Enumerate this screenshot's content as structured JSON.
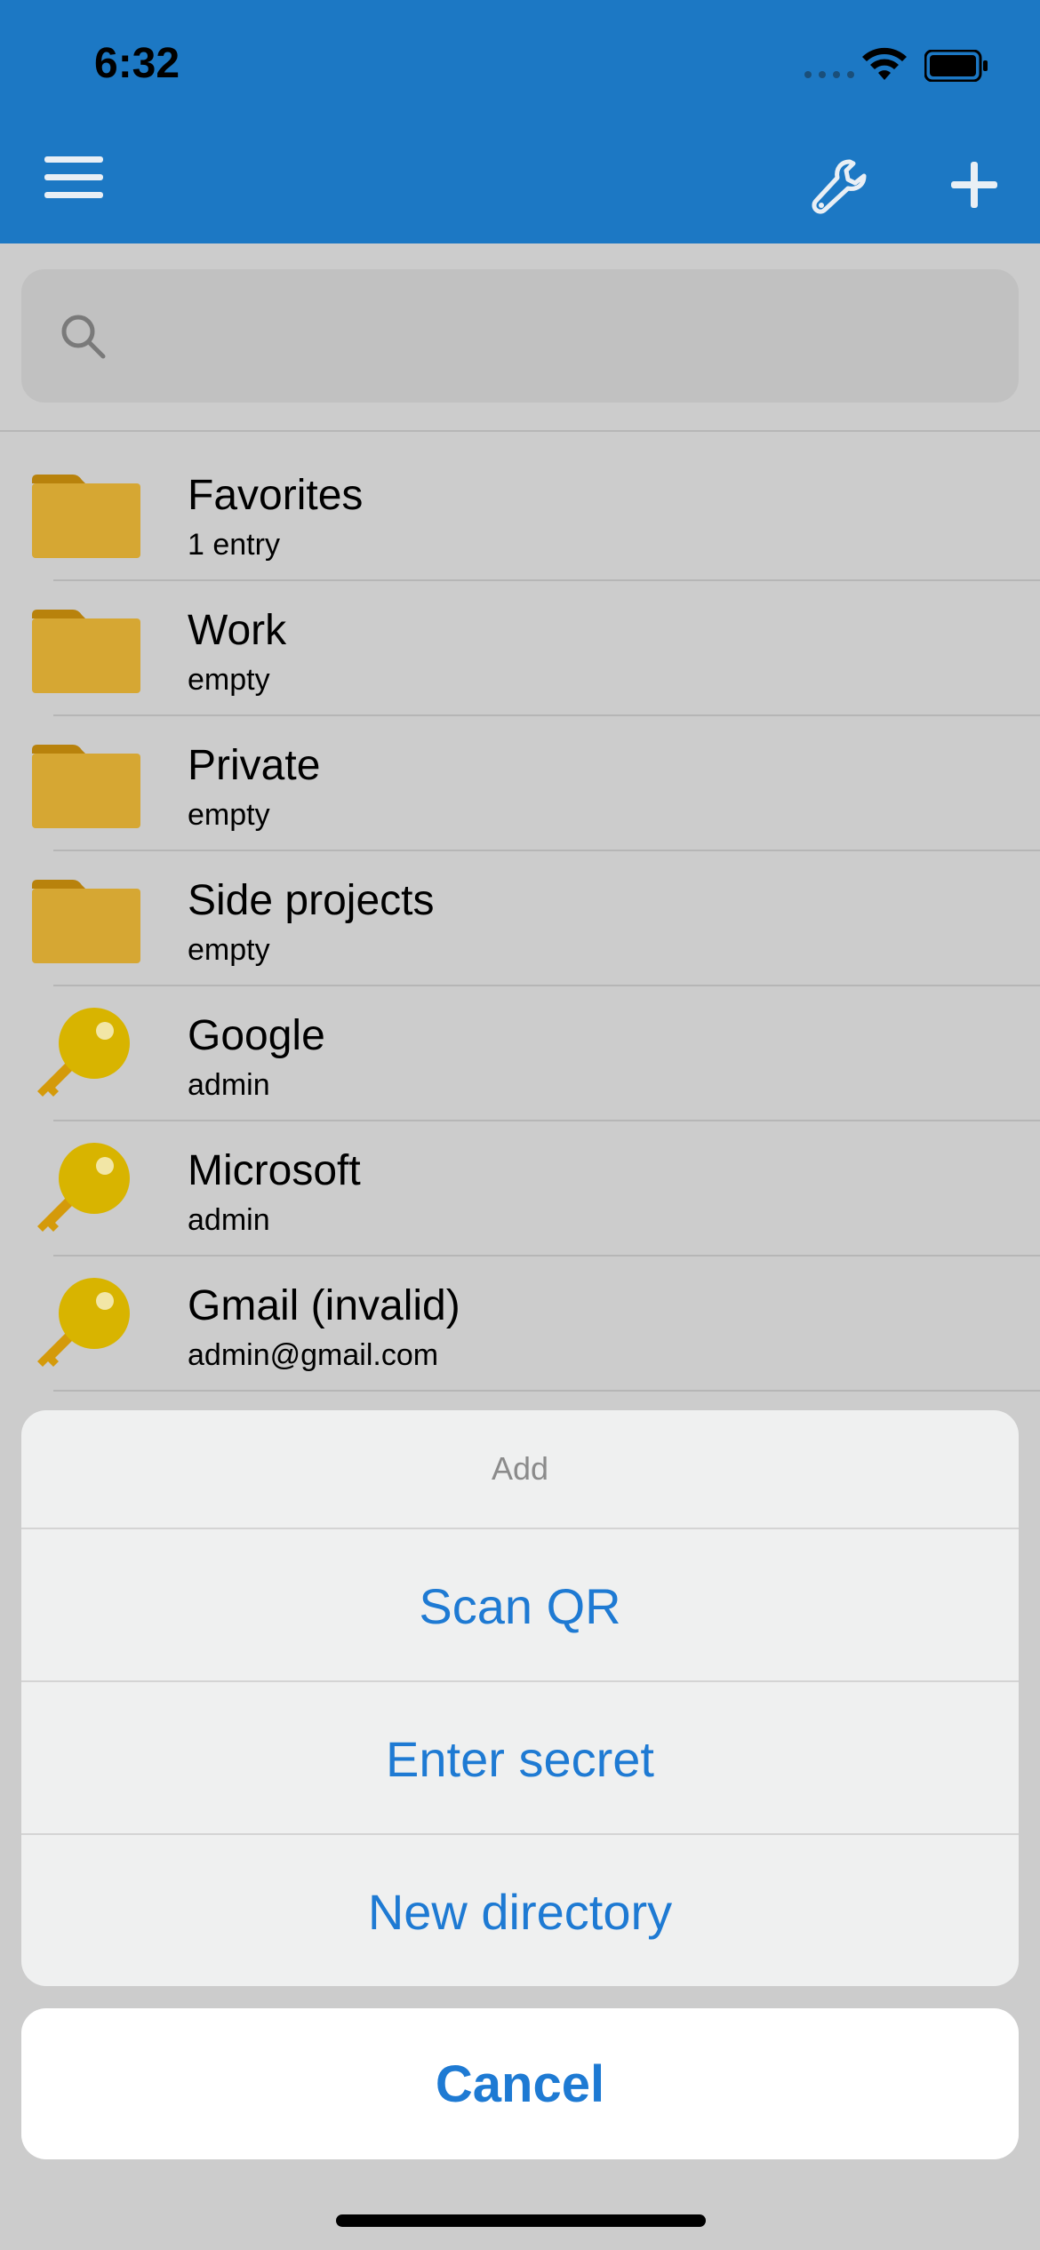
{
  "status": {
    "time": "6:32"
  },
  "nav": {
    "menu_icon": "hamburger-menu-icon",
    "tools_icon": "wrench-icon",
    "add_icon": "plus-icon"
  },
  "search": {
    "placeholder": ""
  },
  "list": [
    {
      "type": "folder",
      "title": "Favorites",
      "subtitle": "1 entry"
    },
    {
      "type": "folder",
      "title": "Work",
      "subtitle": "empty"
    },
    {
      "type": "folder",
      "title": "Private",
      "subtitle": "empty"
    },
    {
      "type": "folder",
      "title": "Side projects",
      "subtitle": "empty"
    },
    {
      "type": "key",
      "title": "Google",
      "subtitle": "admin"
    },
    {
      "type": "key",
      "title": "Microsoft",
      "subtitle": "admin"
    },
    {
      "type": "key",
      "title": "Gmail (invalid)",
      "subtitle": "admin@gmail.com"
    }
  ],
  "sheet": {
    "title": "Add",
    "options": [
      "Scan QR",
      "Enter secret",
      "New directory"
    ],
    "cancel": "Cancel"
  },
  "colors": {
    "accent": "#1e7ad3",
    "bar": "#1c78c4",
    "folder": "#d4a634",
    "key": "#d4b300"
  }
}
